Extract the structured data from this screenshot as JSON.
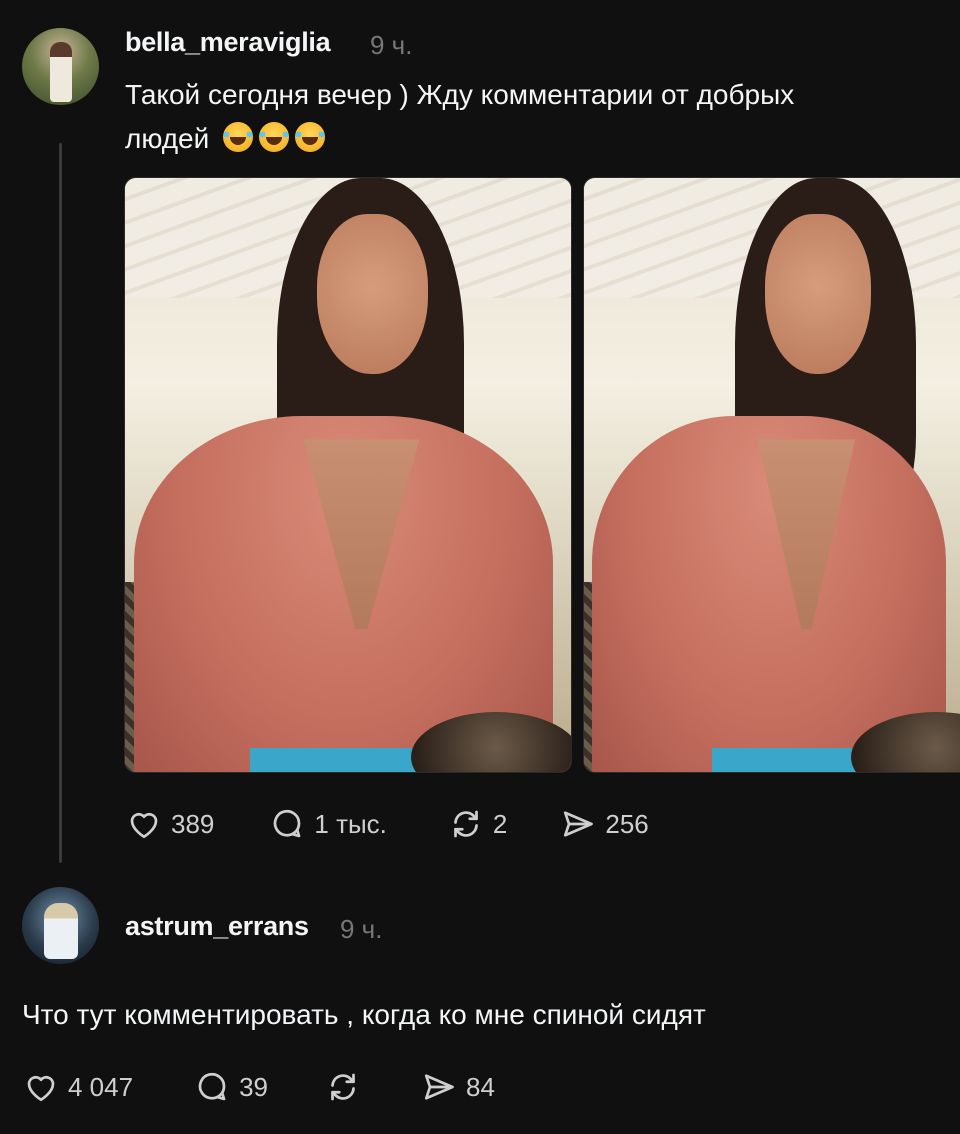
{
  "post": {
    "username": "bella_meraviglia",
    "time": "9 ч.",
    "text_line1": "Такой сегодня вечер ) Жду комментарии от добрых",
    "text_line2": "людей",
    "emoji": [
      "face-with-tears-of-joy",
      "face-with-tears-of-joy",
      "face-with-tears-of-joy"
    ],
    "images": [
      "photo-1",
      "photo-2"
    ],
    "actions": {
      "likes": "389",
      "comments": "1 тыс.",
      "reposts": "2",
      "shares": "256"
    }
  },
  "reply": {
    "username": "astrum_errans",
    "time": "9 ч.",
    "text": "Что тут комментировать , когда ко мне спиной сидят",
    "actions": {
      "likes": "4 047",
      "comments": "39",
      "reposts": "",
      "shares": "84"
    }
  },
  "colors": {
    "background": "#101010",
    "text": "#f3f5f7",
    "muted": "#777777",
    "thread_line": "#3a3a3a"
  }
}
